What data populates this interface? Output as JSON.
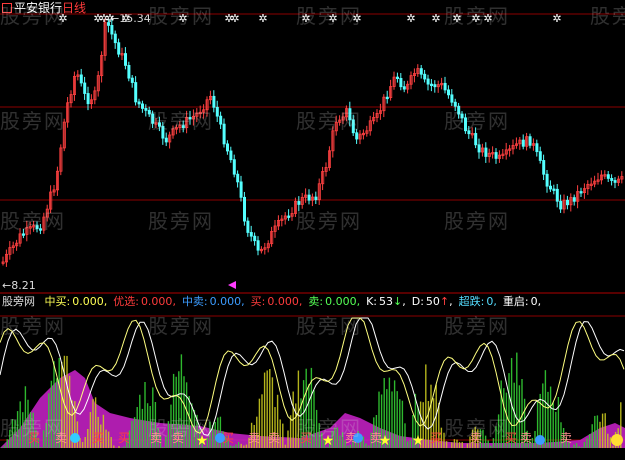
{
  "header": {
    "stock_name": "平安银行",
    "period": "日线"
  },
  "price_labels": {
    "high": "15.34",
    "low": "8.21"
  },
  "indicators": [
    {
      "key": "buy_mid",
      "label": "中买:",
      "value": "0.000",
      "color": "#ffff55"
    },
    {
      "key": "buy_best",
      "label": "优选:",
      "value": "0.000",
      "color": "#ff3c3c"
    },
    {
      "key": "sell_mid",
      "label": "中卖:",
      "value": "0.000",
      "color": "#3c9cff"
    },
    {
      "key": "sell",
      "label": "买:",
      "value": "0.000",
      "color": "#ff3c3c"
    },
    {
      "key": "sell2",
      "label": "卖:",
      "value": "0.000",
      "color": "#55ff55"
    },
    {
      "key": "k",
      "label": "K:",
      "value": "53",
      "arrow": "↓",
      "color": "#ffffff"
    },
    {
      "key": "d",
      "label": "D:",
      "value": "50",
      "arrow": "↑",
      "color": "#ffffff"
    },
    {
      "key": "oversold",
      "label": "超跌:",
      "value": "0",
      "color": "#55ddff"
    },
    {
      "key": "restart",
      "label": "重启:",
      "value": "0",
      "color": "#ffffff"
    }
  ],
  "watermark": {
    "text": "股旁网"
  },
  "signal_labels": {
    "buy": "买",
    "sell": "卖"
  },
  "colors": {
    "up": "#ff4040",
    "down": "#54ffff",
    "grid": "#8b0000",
    "k_line": "#ffffff",
    "d_line": "#ffff80",
    "magenta": "#cc22cc",
    "green": "#33cc33"
  }
}
